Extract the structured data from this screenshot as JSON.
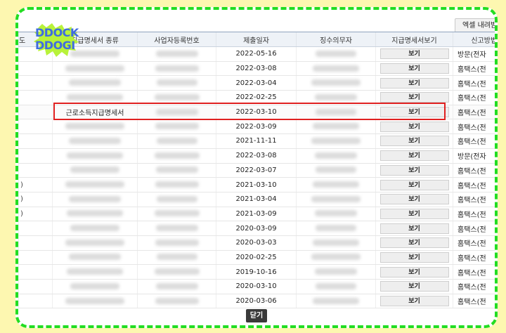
{
  "toolbar": {
    "excel_label": "엑셀 내려받기"
  },
  "logo": {
    "line1": "DDOCK",
    "line2": "DDOGI"
  },
  "table": {
    "columns": [
      "도",
      "지급명세서 종류",
      "사업자등록번호",
      "제출일자",
      "징수의무자",
      "지급명세서보기",
      "신고방법"
    ],
    "view_label": "보기",
    "rows": [
      {
        "lead": "",
        "kind": "",
        "date": "2022-05-16",
        "method": "방문(전자"
      },
      {
        "lead": "",
        "kind": "",
        "date": "2022-03-08",
        "method": "홈택스(전"
      },
      {
        "lead": "",
        "kind": "",
        "date": "2022-03-04",
        "method": "홈택스(전"
      },
      {
        "lead": "",
        "kind": "",
        "date": "2022-02-25",
        "method": "홈택스(전"
      },
      {
        "lead": "",
        "kind": "근로소득지급명세서",
        "date": "2022-03-10",
        "method": "홈택스(전"
      },
      {
        "lead": "",
        "kind": "",
        "date": "2022-03-09",
        "method": "홈택스(전"
      },
      {
        "lead": "",
        "kind": "",
        "date": "2021-11-11",
        "method": "홈택스(전"
      },
      {
        "lead": "",
        "kind": "",
        "date": "2022-03-08",
        "method": "방문(전자"
      },
      {
        "lead": "",
        "kind": "",
        "date": "2022-03-07",
        "method": "홈택스(전"
      },
      {
        "lead": ")",
        "kind": "",
        "date": "2021-03-10",
        "method": "홈택스(전"
      },
      {
        "lead": ")",
        "kind": "",
        "date": "2021-03-04",
        "method": "홈택스(전"
      },
      {
        "lead": ")",
        "kind": "",
        "date": "2021-03-09",
        "method": "홈택스(전"
      },
      {
        "lead": "",
        "kind": "",
        "date": "2020-03-09",
        "method": "홈택스(전"
      },
      {
        "lead": "",
        "kind": "",
        "date": "2020-03-03",
        "method": "홈택스(전"
      },
      {
        "lead": "",
        "kind": "",
        "date": "2020-02-25",
        "method": "홈택스(전"
      },
      {
        "lead": "",
        "kind": "",
        "date": "2019-10-16",
        "method": "홈택스(전"
      },
      {
        "lead": "",
        "kind": "",
        "date": "2020-03-10",
        "method": "홈택스(전"
      },
      {
        "lead": "",
        "kind": "",
        "date": "2020-03-06",
        "method": "홈택스(전"
      }
    ]
  },
  "footer": {
    "close_label": "닫기"
  },
  "colors": {
    "frame": "#22dd22",
    "highlight": "#e02020",
    "background": "#fdf7b0",
    "logo": "#3f6ce0"
  }
}
